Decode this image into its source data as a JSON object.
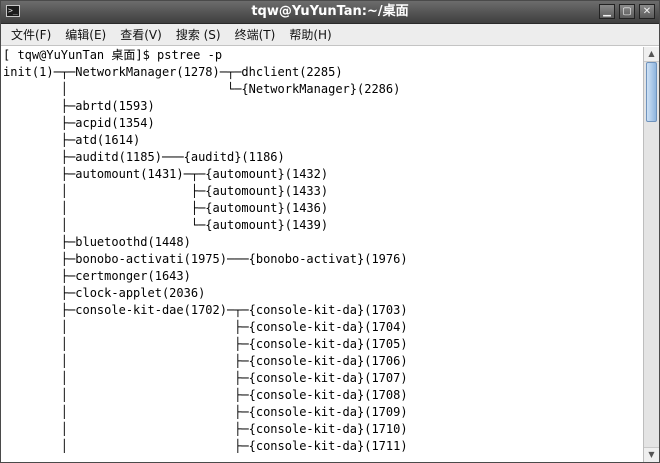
{
  "window": {
    "title": "tqw@YuYunTan:~/桌面",
    "icon": "terminal-icon",
    "controls": [
      "minimize-icon",
      "maximize-icon",
      "close-icon"
    ]
  },
  "menu": [
    "文件(F)",
    "编辑(E)",
    "查看(V)",
    "搜索 (S)",
    "终端(T)",
    "帮助(H)"
  ],
  "terminal_lines": [
    "[ tqw@YuYunTan 桌面]$ pstree -p",
    "init(1)─┬─NetworkManager(1278)─┬─dhclient(2285)",
    "        │                      └─{NetworkManager}(2286)",
    "        ├─abrtd(1593)",
    "        ├─acpid(1354)",
    "        ├─atd(1614)",
    "        ├─auditd(1185)───{auditd}(1186)",
    "        ├─automount(1431)─┬─{automount}(1432)",
    "        │                 ├─{automount}(1433)",
    "        │                 ├─{automount}(1436)",
    "        │                 └─{automount}(1439)",
    "        ├─bluetoothd(1448)",
    "        ├─bonobo-activati(1975)───{bonobo-activat}(1976)",
    "        ├─certmonger(1643)",
    "        ├─clock-applet(2036)",
    "        ├─console-kit-dae(1702)─┬─{console-kit-da}(1703)",
    "        │                       ├─{console-kit-da}(1704)",
    "        │                       ├─{console-kit-da}(1705)",
    "        │                       ├─{console-kit-da}(1706)",
    "        │                       ├─{console-kit-da}(1707)",
    "        │                       ├─{console-kit-da}(1708)",
    "        │                       ├─{console-kit-da}(1709)",
    "        │                       ├─{console-kit-da}(1710)",
    "        │                       ├─{console-kit-da}(1711)"
  ],
  "scrollbar": {
    "position": 0.0,
    "up_icon": "arrow-up-icon",
    "down_icon": "arrow-down-icon"
  }
}
